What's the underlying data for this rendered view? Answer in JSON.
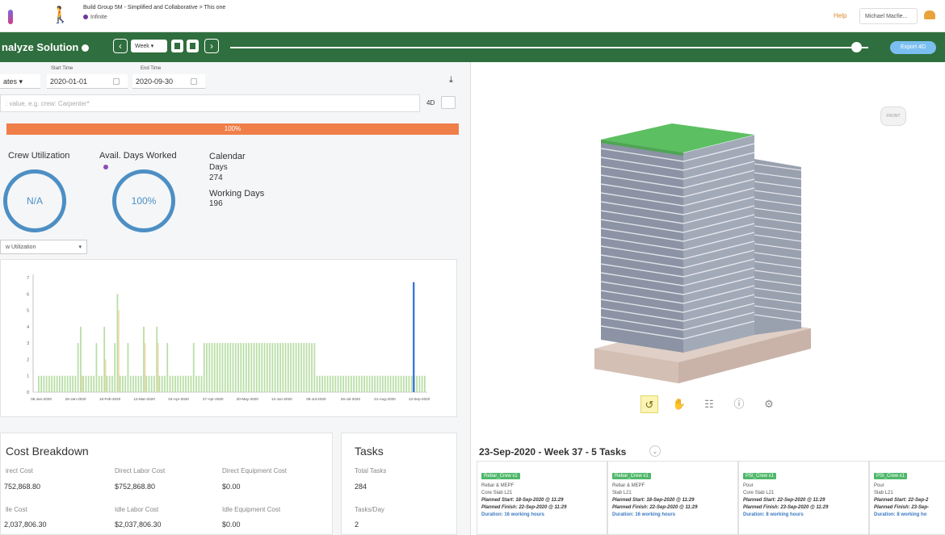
{
  "header": {
    "project_name": "Build Group 5M - Simplified and Collaborative > This one",
    "status": "Infinite",
    "help": "Help",
    "user": "Michael Macfie..."
  },
  "toolbar": {
    "title": "nalyze Solution",
    "period": "Week",
    "export_label": "Export 4D"
  },
  "filters": {
    "start_label": "Start Time",
    "end_label": "End Time",
    "group_value": "ates",
    "start_value": "2020-01-01",
    "end_value": "2020-09-30",
    "search_placeholder": ": value, e.g. crew: Carpenter*",
    "fourd_label": "4D"
  },
  "progress_label": "100%",
  "stats": {
    "crew_util_title": "Crew Utilization",
    "crew_util_value": "N/A",
    "avail_days_title": "Avail. Days Worked",
    "avail_days_value": "100%",
    "calendar_label": "Calendar",
    "days_label": "Days",
    "days_value": "274",
    "working_days_label": "Working Days",
    "working_days_value": "196"
  },
  "chart_selector": "w Utilization",
  "chart_data": {
    "type": "bar",
    "y_ticks": [
      "0",
      "1",
      "2",
      "3",
      "4",
      "5",
      "6",
      "7"
    ],
    "ylim": [
      0,
      7
    ],
    "x_ticks": [
      "06-Jan-2020",
      "26-Jan-2020",
      "16-Feb-2020",
      "12-Mar-2020",
      "04-Apr-2020",
      "27-Apr-2020",
      "20-May-2020",
      "12-Jun-2020",
      "06-Jul-2020",
      "26-Jul-2020",
      "21-Aug-2020",
      "13-Sep-2020"
    ],
    "series": [
      {
        "values": [
          1,
          1,
          1,
          1,
          1,
          1,
          1,
          1,
          1,
          1,
          1,
          1,
          1,
          1,
          1,
          3,
          4,
          1,
          1,
          1,
          1,
          1,
          3,
          1,
          1,
          4,
          1,
          1,
          1,
          3,
          6,
          1,
          1,
          1,
          3,
          1,
          1,
          1,
          1,
          1,
          4,
          1,
          1,
          1,
          1,
          4,
          1,
          1,
          1,
          3,
          1,
          1,
          1,
          1,
          1,
          1,
          1,
          1,
          1,
          3,
          1,
          1,
          1,
          3,
          3,
          3,
          3,
          3,
          3,
          3,
          3,
          3,
          3,
          3,
          3,
          3,
          3,
          3,
          3,
          3,
          3,
          3,
          3,
          3,
          3,
          3,
          3,
          3,
          3,
          3,
          3,
          3,
          3,
          3,
          3,
          3,
          3,
          3,
          3,
          3,
          3,
          3,
          3,
          3,
          3,
          3,
          1,
          1,
          1,
          1,
          1,
          1,
          1,
          1,
          1,
          1,
          1,
          1,
          1,
          1,
          1,
          1,
          1,
          1,
          1,
          1,
          1,
          1,
          1,
          1,
          1,
          1,
          1,
          1,
          1,
          1,
          1,
          1,
          1,
          1,
          1,
          1,
          1,
          1,
          1,
          1,
          1,
          1
        ]
      },
      {
        "values": [
          0,
          0,
          0,
          0,
          0,
          0,
          0,
          0,
          0,
          0,
          0,
          0,
          0,
          0,
          0,
          0,
          1,
          0,
          0,
          0,
          0,
          0,
          0,
          0,
          0,
          2,
          0,
          0,
          0,
          0,
          5,
          0,
          0,
          0,
          0,
          0,
          0,
          0,
          0,
          0,
          3,
          0,
          0,
          0,
          0,
          3,
          0,
          0,
          0,
          0,
          0,
          0,
          0,
          0,
          0,
          0,
          0,
          0,
          0,
          0,
          0,
          0,
          0,
          0,
          0,
          0,
          0,
          0,
          0,
          0,
          0,
          0,
          0,
          0,
          0,
          0,
          0,
          0,
          0,
          0,
          0,
          0,
          0,
          0,
          0,
          0,
          0,
          0,
          0,
          0,
          0,
          0,
          0,
          0,
          0,
          0,
          0,
          0,
          0,
          0,
          0,
          0,
          0,
          0,
          0,
          0,
          0,
          0,
          0,
          0,
          0,
          0,
          0,
          0,
          0,
          0,
          0,
          0,
          0,
          0,
          0,
          0,
          0,
          0,
          0,
          0,
          0,
          0,
          0,
          0,
          0,
          0,
          0,
          0,
          0,
          0,
          0,
          0,
          0,
          0,
          0,
          0,
          0,
          0,
          0,
          0,
          0,
          0
        ]
      }
    ],
    "marker_index": 143,
    "colors": {
      "primary": "#b9dea6",
      "secondary": "#f1d8a3",
      "marker": "#3c78d8"
    }
  },
  "cost": {
    "title": "Cost Breakdown",
    "direct_cost_label": "irect Cost",
    "direct_cost_value": "752,868.80",
    "direct_labor_label": "Direct Labor Cost",
    "direct_labor_value": "$752,868.80",
    "direct_equip_label": "Direct Equipment Cost",
    "direct_equip_value": "$0.00",
    "idle_cost_label": "lle Cost",
    "idle_cost_value": "2,037,806.30",
    "idle_labor_label": "Idle Labor Cost",
    "idle_labor_value": "$2,037,806.30",
    "idle_equip_label": "Idle Equipment Cost",
    "idle_equip_value": "$0.00"
  },
  "tasks": {
    "title": "Tasks",
    "total_label": "Total Tasks",
    "total_value": "284",
    "per_day_label": "Tasks/Day",
    "per_day_value": "2"
  },
  "week": {
    "heading": "23-Sep-2020 - Week 37 - 5 Tasks",
    "cards": [
      {
        "crew": "Rebar_Crew x1",
        "activity": "Rebar & MEPF",
        "location": "Core Slab L21",
        "start": "Planned Start: 18-Sep-2020 @ 11:29",
        "finish": "Planned Finish: 22-Sep-2020 @ 11:29",
        "duration": "Duration: 16 working hours"
      },
      {
        "crew": "Rebar_Crew x1",
        "activity": "Rebar & MEPF",
        "location": "Slab L21",
        "start": "Planned Start: 18-Sep-2020 @ 11:29",
        "finish": "Planned Finish: 22-Sep-2020 @ 11:29",
        "duration": "Duration: 16 working hours"
      },
      {
        "crew": "PSI_Crew x1",
        "activity": "Pour",
        "location": "Core Slab L21",
        "start": "Planned Start: 22-Sep-2020 @ 11:29",
        "finish": "Planned Finish: 23-Sep-2020 @ 11:29",
        "duration": "Duration: 8 working hours"
      },
      {
        "crew": "PSI_Crew x1",
        "activity": "Pour",
        "location": "Slab L21",
        "start": "Planned Start: 22-Sep-2",
        "finish": "Planned Finish: 23-Sep-",
        "duration": "Duration: 8 working ho"
      }
    ]
  }
}
